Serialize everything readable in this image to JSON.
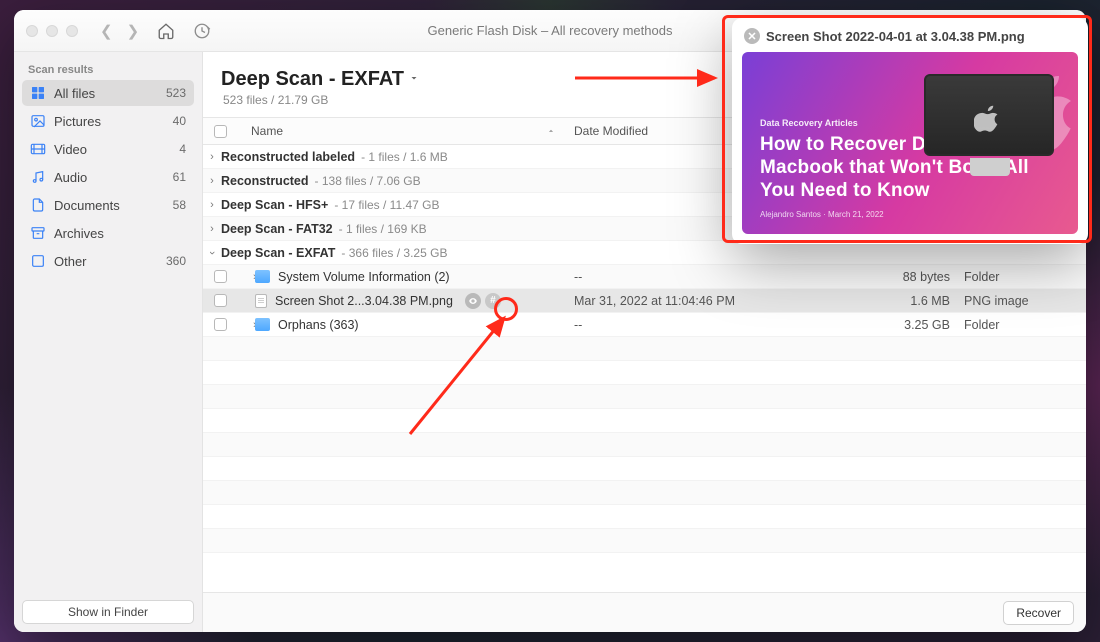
{
  "window": {
    "title": "Generic Flash Disk – All recovery methods"
  },
  "sidebar": {
    "section": "Scan results",
    "items": [
      {
        "label": "All files",
        "count": "523",
        "icon": "grid"
      },
      {
        "label": "Pictures",
        "count": "40",
        "icon": "image"
      },
      {
        "label": "Video",
        "count": "4",
        "icon": "video"
      },
      {
        "label": "Audio",
        "count": "61",
        "icon": "audio"
      },
      {
        "label": "Documents",
        "count": "58",
        "icon": "doc"
      },
      {
        "label": "Archives",
        "count": "",
        "icon": "archive"
      },
      {
        "label": "Other",
        "count": "360",
        "icon": "other"
      }
    ],
    "footer_button": "Show in Finder"
  },
  "main": {
    "title": "Deep Scan - EXFAT",
    "subtitle": "523 files / 21.79 GB",
    "columns": {
      "name": "Name",
      "date": "Date Modified"
    },
    "groups": [
      {
        "label": "Reconstructed labeled",
        "meta": "- 1 files / 1.6 MB"
      },
      {
        "label": "Reconstructed",
        "meta": "- 138 files / 7.06 GB"
      },
      {
        "label": "Deep Scan - HFS+",
        "meta": "- 17 files / 11.47 GB"
      },
      {
        "label": "Deep Scan - FAT32",
        "meta": "- 1 files / 169 KB"
      },
      {
        "label": "Deep Scan - EXFAT",
        "meta": "- 366 files / 3.25 GB"
      }
    ],
    "children": [
      {
        "name": "System Volume Information (2)",
        "date": "--",
        "size": "88 bytes",
        "kind": "Folder",
        "type": "folder"
      },
      {
        "name": "Screen Shot 2...3.04.38 PM.png",
        "date": "Mar 31, 2022 at 11:04:46 PM",
        "size": "1.6 MB",
        "kind": "PNG image",
        "type": "file"
      },
      {
        "name": "Orphans (363)",
        "date": "--",
        "size": "3.25 GB",
        "kind": "Folder",
        "type": "folder"
      }
    ],
    "recover_button": "Recover"
  },
  "popover": {
    "title": "Screen Shot 2022-04-01 at 3.04.38 PM.png",
    "eyebrow": "Data Recovery Articles",
    "headline": "How to Recover Data from Macbook that Won't Boot: All You Need to Know",
    "byline": "Alejandro Santos · March 21, 2022"
  }
}
